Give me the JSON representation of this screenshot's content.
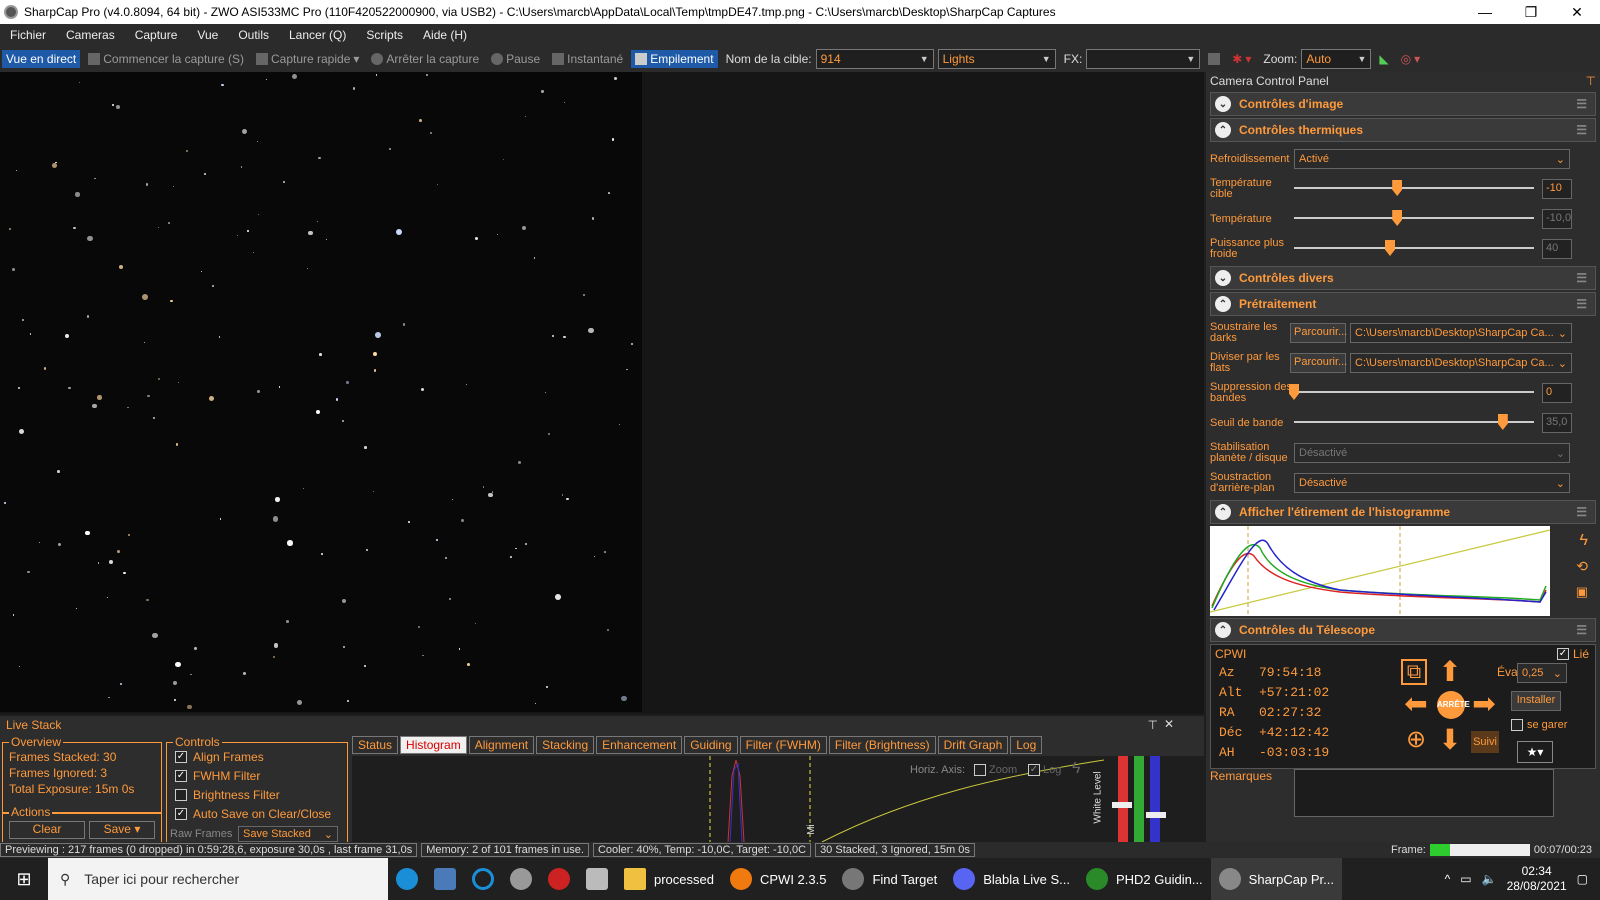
{
  "titlebar": {
    "title": "SharpCap Pro (v4.0.8094, 64 bit) - ZWO ASI533MC Pro (110F420522000900, via USB2) - C:\\Users\\marcb\\AppData\\Local\\Temp\\tmpDE47.tmp.png - C:\\Users\\marcb\\Desktop\\SharpCap Captures",
    "minimize": "—",
    "maximize": "❐",
    "close": "✕"
  },
  "menu": [
    "Fichier",
    "Cameras",
    "Capture",
    "Vue",
    "Outils",
    "Lancer (Q)",
    "Scripts",
    "Aide (H)"
  ],
  "toolbar": {
    "live": "Vue en direct",
    "start_capture": "Commencer la capture (S)",
    "quick_capture": "Capture rapide",
    "stop_capture": "Arrêter la capture",
    "pause": "Pause",
    "snapshot": "Instantané",
    "stacking": "Empilement",
    "target_label": "Nom de la cible:",
    "target_value": "914",
    "frame_type": "Lights",
    "fx_label": "FX:",
    "fx_value": "",
    "zoom_label": "Zoom:",
    "zoom_value": "Auto"
  },
  "panel": {
    "title": "Camera Control Panel",
    "sections": {
      "image": "Contrôles d'image",
      "thermal": "Contrôles thermiques",
      "misc": "Contrôles divers",
      "preprocessing": "Prétraitement",
      "histogram": "Afficher l'étirement de l'histogramme",
      "telescope": "Contrôles du Télescope"
    },
    "thermal": {
      "cooling_label": "Refroidissement",
      "cooling_value": "Activé",
      "target_temp_label": "Température cible",
      "target_temp_value": "-10",
      "target_temp_fraction": 0.43,
      "temp_label": "Température",
      "temp_value": "-10,0",
      "temp_fraction": 0.43,
      "power_label": "Puissance plus froide",
      "power_value": "40",
      "power_fraction": 0.4
    },
    "preprocessing": {
      "darks_label": "Soustraire les darks",
      "darks_browse": "Parcourir...",
      "darks_path": "C:\\Users\\marcb\\Desktop\\SharpCap Ca...",
      "flats_label": "Diviser par les flats",
      "flats_browse": "Parcourir...",
      "flats_path": "C:\\Users\\marcb\\Desktop\\SharpCap Ca...",
      "banding_label": "Suppression des bandes",
      "banding_value": "0",
      "banding_fraction": 0.0,
      "threshold_label": "Seuil de bande",
      "threshold_value": "35,0",
      "threshold_fraction": 0.87,
      "stabilisation_label": "Stabilisation planète / disque",
      "stabilisation_value": "Désactivé",
      "background_label": "Soustraction d'arrière-plan",
      "background_value": "Désactivé"
    },
    "telescope": {
      "mount": "CPWI",
      "linked_label": "Lié",
      "az_label": "Az",
      "az_value": "79:54:18",
      "alt_label": "Alt",
      "alt_value": "+57:21:02",
      "ra_label": "RA",
      "ra_value": "02:27:32",
      "dec_label": "Déc",
      "dec_value": "+42:12:42",
      "ah_label": "AH",
      "ah_value": "-03:03:19",
      "rate_label": "Évaluer:",
      "rate_value": "0,25",
      "install": "Installer",
      "park": "se garer",
      "stop": "ARRÊTE",
      "track": "Suivi",
      "notes_label": "Remarques"
    }
  },
  "livestack": {
    "title": "Live Stack",
    "overview_label": "Overview",
    "frames_stacked": "Frames Stacked: 30",
    "frames_ignored": "Frames Ignored:   3",
    "total_exposure": "Total Exposure:   15m 0s",
    "actions_label": "Actions",
    "clear": "Clear",
    "save": "Save",
    "raw_frames": "Raw Frames",
    "raw_frames_value": "Save Stacked",
    "controls_label": "Controls",
    "controls": [
      {
        "label": "Align Frames",
        "checked": "✓"
      },
      {
        "label": "FWHM Filter",
        "checked": "✓"
      },
      {
        "label": "Brightness Filter",
        "checked": ""
      },
      {
        "label": "Auto Save on Clear/Close",
        "checked": "✓"
      }
    ],
    "tabs": [
      "Status",
      "Histogram",
      "Alignment",
      "Stacking",
      "Enhancement",
      "Guiding",
      "Filter (FWHM)",
      "Filter (Brightness)",
      "Drift Graph",
      "Log"
    ],
    "horiz_axis": "Horiz. Axis:",
    "zoom": "Zoom",
    "log": "Log",
    "white_level": "White Level",
    "mid": "Mi"
  },
  "statusbar": {
    "preview": "Previewing : 217 frames (0 dropped) in 0:59:28,6, exposure 30,0s , last frame 31,0s",
    "memory": "Memory: 2 of 101 frames in use.",
    "cooler": "Cooler: 40%, Temp: -10,0C, Target: -10,0C",
    "stacked": "30 Stacked, 3 Ignored, 15m 0s",
    "frame_label": "Frame:",
    "frame_progress": 0.2,
    "frame_time": "00:07/00:23"
  },
  "taskbar": {
    "search": "Taper ici pour rechercher",
    "apps": [
      "processed",
      "CPWI 2.3.5",
      "Find Target",
      "Blabla Live S...",
      "PHD2 Guidin...",
      "SharpCap Pr..."
    ],
    "time": "02:34",
    "date": "28/08/2021"
  }
}
